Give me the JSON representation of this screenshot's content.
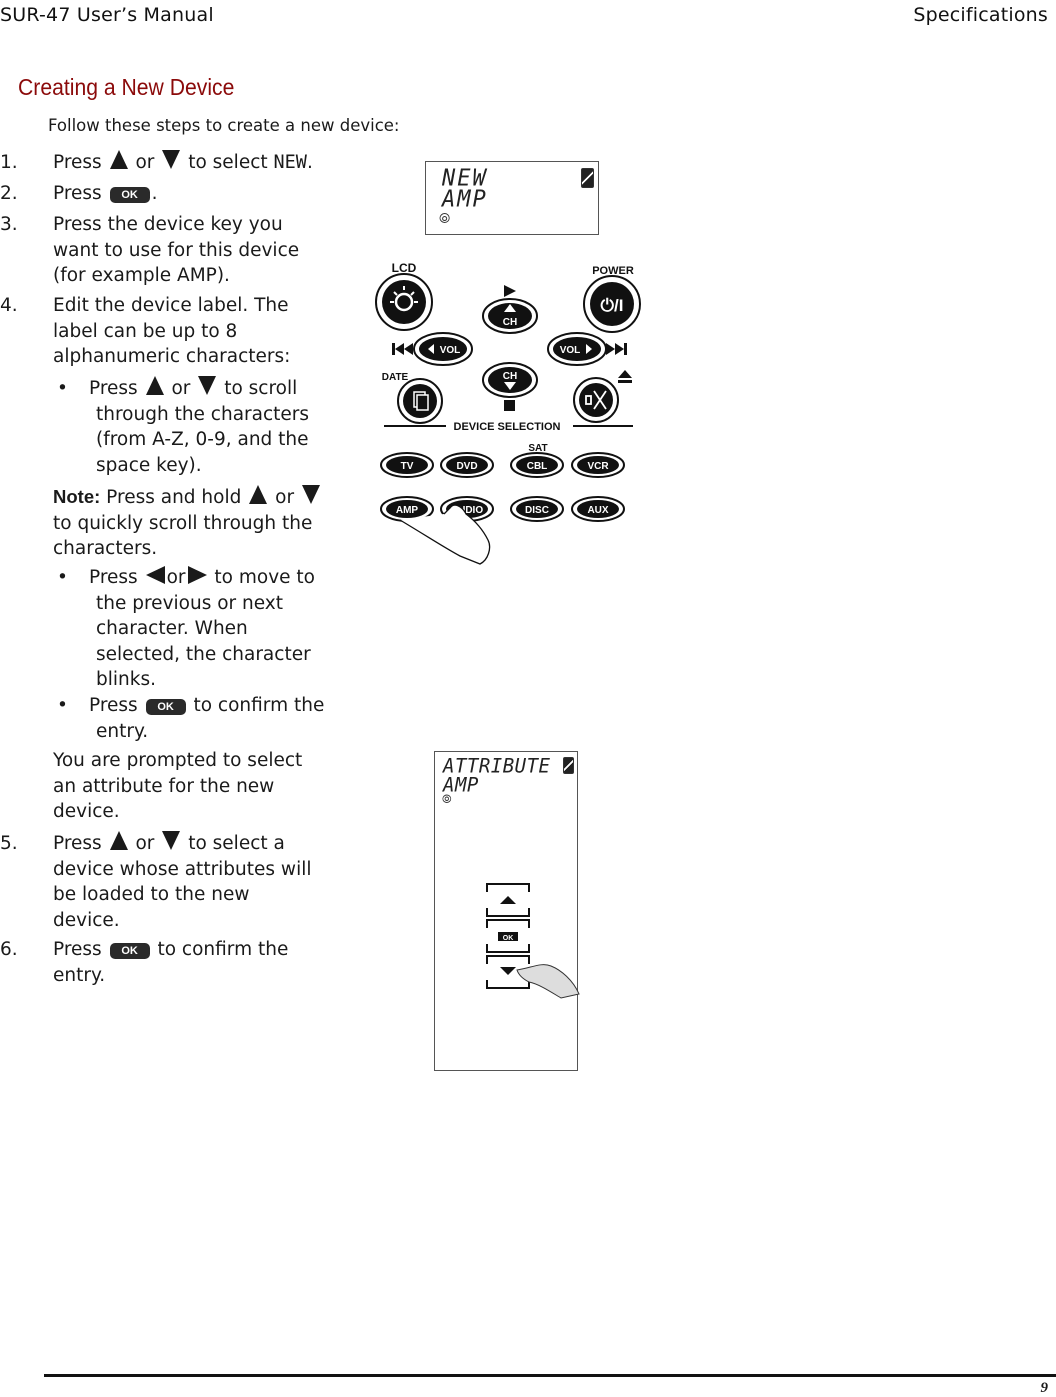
{
  "header": {
    "left": "SUR-47 User’s Manual",
    "right": "Specifications"
  },
  "section_title": "Creating a New Device",
  "intro": "Follow these steps to create a new device:",
  "steps": [
    {
      "num": "1.",
      "pre": "Press",
      "mid": "or",
      "post": "to select",
      "code": "NEW",
      "end": "."
    },
    {
      "num": "2.",
      "pre": "Press",
      "post": "."
    },
    {
      "num": "3.",
      "lines": [
        "Press the device key you",
        "want to use for this device",
        "(for example AMP)."
      ]
    },
    {
      "num": "4.",
      "lines": [
        "Edit the device label. The",
        "label can be up to 8",
        "alphanumeric characters:"
      ]
    },
    {
      "num": "5.",
      "pre": "Press",
      "mid": "or",
      "post": "to select a",
      "lines": [
        "device whose attributes will",
        "be loaded to the new",
        "device."
      ]
    },
    {
      "num": "6.",
      "pre": "Press",
      "post": "to confirm the",
      "lines": [
        "entry."
      ]
    }
  ],
  "bullets": [
    {
      "dot": "•",
      "pre": "Press",
      "mid": "or",
      "post": "to scroll",
      "lines": [
        "through the characters",
        "(from A-Z, 0-9, and the",
        "space key)."
      ]
    },
    {
      "dot": "•",
      "pre": "Press",
      "mid": "or",
      "post": "to move to",
      "lines": [
        "the previous or next",
        "character. When",
        "selected, the character",
        "blinks."
      ]
    },
    {
      "dot": "•",
      "pre": "Press",
      "post": "to confirm the",
      "lines": [
        "entry."
      ]
    }
  ],
  "note": {
    "label": "Note:",
    "pre": "Press and hold",
    "mid": "or",
    "lines": [
      "to quickly scroll through the",
      "characters."
    ]
  },
  "prompt_lines": [
    "You are prompted to select",
    "an attribute for the new",
    "device."
  ],
  "ok_key_label": "OK",
  "lcd1": {
    "line1": "NEW",
    "line2": "AMP"
  },
  "lcd2": {
    "line1": "ATTRIBUTE",
    "line2": "AMP",
    "ok_label": "OK"
  },
  "remote": {
    "lcd_label": "LCD",
    "power_label": "POWER",
    "power_glyph": "⏻/I",
    "date_label": "DATE",
    "ch_label": "CH",
    "vol_label": "VOL",
    "device_selection_label": "DEVICE SELECTION",
    "sat_label": "SAT",
    "device_keys": [
      "TV",
      "DVD",
      "CBL",
      "VCR",
      "AMP",
      "AUDIO",
      "DISC",
      "AUX"
    ]
  },
  "footer": {
    "page_number": "9"
  }
}
